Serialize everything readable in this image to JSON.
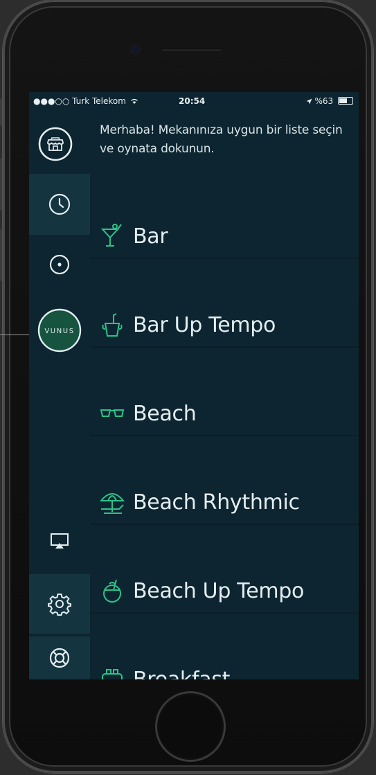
{
  "status_bar": {
    "carrier": "●●●○○ Turk Telekom",
    "time": "20:54",
    "battery": "%63"
  },
  "greeting": "Merhaba! Mekanınıza uygun bir liste seçin ve oynata dokunun.",
  "sidebar": {
    "items": [
      {
        "name": "store-icon"
      },
      {
        "name": "clock-icon"
      },
      {
        "name": "compass-icon"
      },
      {
        "name": "vunus-logo",
        "text": "VUNUS"
      },
      {
        "name": "airplay-icon"
      },
      {
        "name": "gear-icon"
      },
      {
        "name": "lifebuoy-icon"
      }
    ]
  },
  "playlists": [
    {
      "label": "Bar",
      "icon": "cocktail-icon"
    },
    {
      "label": "Bar Up Tempo",
      "icon": "champagne-bucket-icon"
    },
    {
      "label": "Beach",
      "icon": "sunglasses-icon"
    },
    {
      "label": "Beach Rhythmic",
      "icon": "beach-umbrella-icon"
    },
    {
      "label": "Beach Up Tempo",
      "icon": "coconut-drink-icon"
    },
    {
      "label": "Breakfast",
      "icon": "toaster-icon"
    }
  ],
  "colors": {
    "background": "#0d2530",
    "sidebar_highlight": "#143440",
    "accent": "#2bc48a",
    "text": "#e4edf0"
  }
}
